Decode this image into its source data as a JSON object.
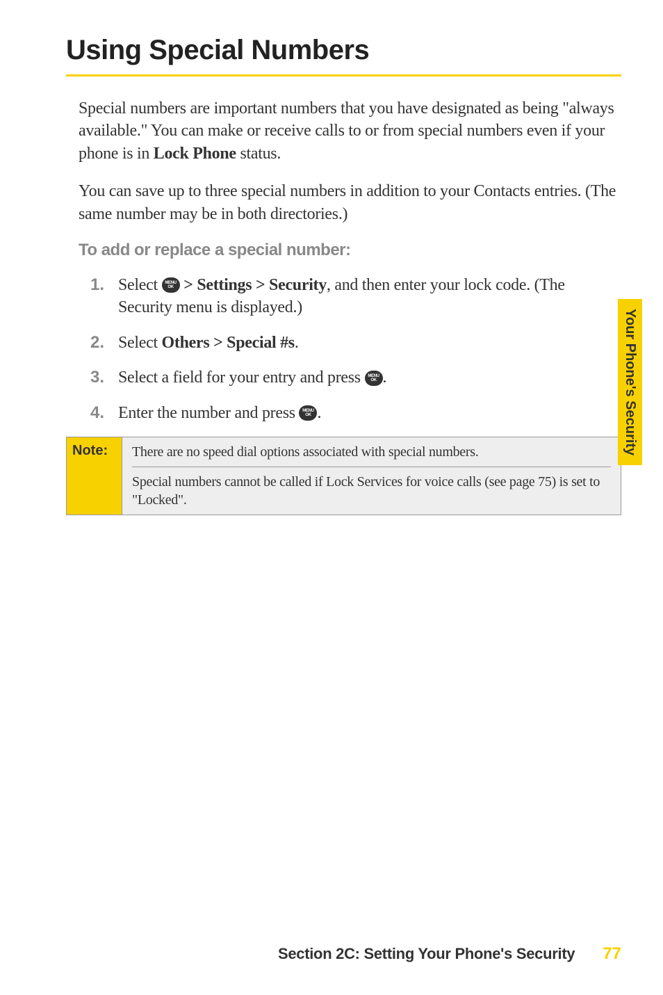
{
  "heading": "Using Special Numbers",
  "para1_pre": "Special numbers are important numbers that you have designated as being \"always available.\" You can make or receive calls to or from special numbers even if your phone is in ",
  "para1_bold": "Lock Phone",
  "para1_post": " status.",
  "para2": "You can save up to three special numbers in addition to your Contacts entries. (The same number may be in both directories.)",
  "subheading": "To add or replace a special number:",
  "steps": [
    {
      "num": "1.",
      "pre": "Select ",
      "icon": true,
      "mid_bold": " > Settings > Security",
      "post": ", and then enter your lock code. (The Security menu is displayed.)"
    },
    {
      "num": "2.",
      "pre": "Select ",
      "icon": false,
      "mid_bold": "Others > Special #s",
      "post": "."
    },
    {
      "num": "3.",
      "pre": "Select a field for your entry and press ",
      "icon_end": true,
      "post": "."
    },
    {
      "num": "4.",
      "pre": "Enter the number and press ",
      "icon_end": true,
      "post": "."
    }
  ],
  "note_label": "Note:",
  "note1": "There are no speed dial options associated with special numbers.",
  "note2": "Special numbers cannot be called if Lock Services for voice calls (see page 75) is set to \"Locked\".",
  "side_tab": "Your Phone's Security",
  "footer_text": "Section 2C: Setting Your Phone's Security",
  "footer_page": "77",
  "menu_ok_top": "MENU",
  "menu_ok_bottom": "OK"
}
